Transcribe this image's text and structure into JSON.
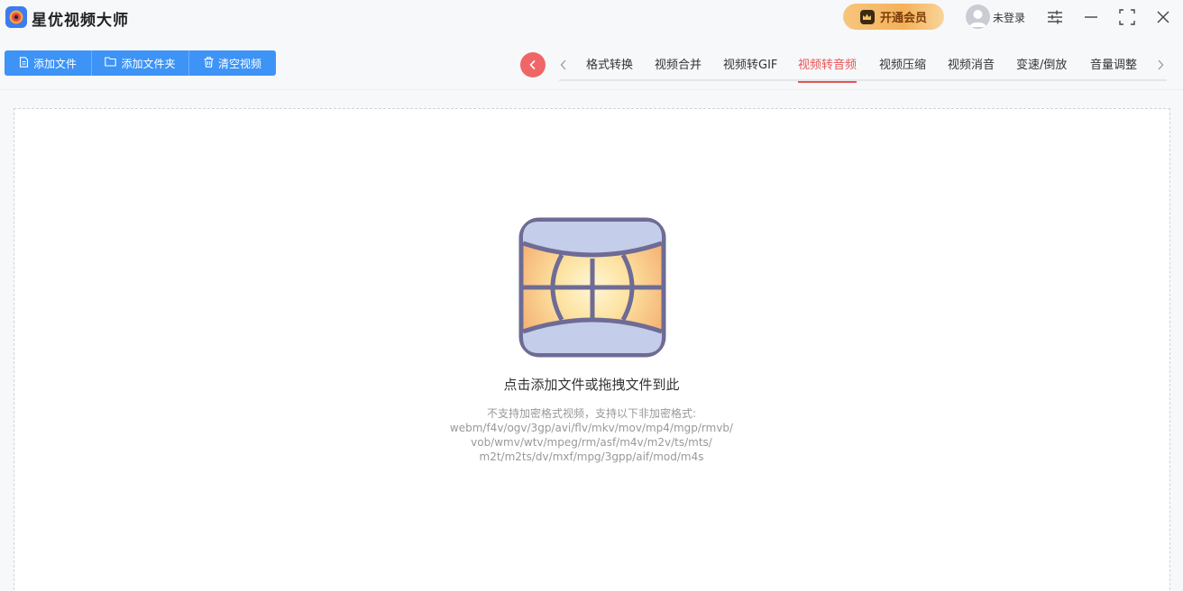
{
  "app": {
    "title": "星优视频大师"
  },
  "header": {
    "vip_label": "开通会员",
    "login_label": "未登录"
  },
  "toolbar": {
    "add_file": "添加文件",
    "add_folder": "添加文件夹",
    "clear_videos": "清空视频"
  },
  "tabs": [
    {
      "label": "格式转换"
    },
    {
      "label": "视频合并"
    },
    {
      "label": "视频转GIF"
    },
    {
      "label": "视频转音频"
    },
    {
      "label": "视频压缩"
    },
    {
      "label": "视频消音"
    },
    {
      "label": "变速/倒放"
    },
    {
      "label": "音量调整"
    }
  ],
  "active_tab": "视频转音频",
  "dropzone": {
    "title": "点击添加文件或拖拽文件到此",
    "hint_lines": [
      "不支持加密格式视频，支持以下非加密格式:",
      "webm/f4v/ogv/3gp/avi/flv/mkv/mov/mp4/mgp/rmvb/",
      "vob/wmv/wtv/mpeg/rm/asf/m4v/m2v/ts/mts/",
      "m2t/m2ts/dv/mxf/mpg/3gpp/aif/mod/m4s"
    ]
  },
  "colors": {
    "primary_blue": "#3d93f6",
    "active_red": "#e65555",
    "vip_gold": "#f5b15a"
  },
  "icons": {
    "app_logo": "app-logo-icon",
    "vip_crown": "crown-icon",
    "avatar": "user-avatar-icon",
    "settings": "settings-sliders-icon",
    "minimize": "minimize-icon",
    "maximize": "maximize-icon",
    "close": "close-icon",
    "add_file": "file-icon",
    "add_folder": "folder-icon",
    "clear": "trash-icon",
    "back": "chevron-left-icon",
    "tab_prev": "chevron-left-icon",
    "tab_next": "chevron-right-icon",
    "drop": "video-film-icon"
  }
}
